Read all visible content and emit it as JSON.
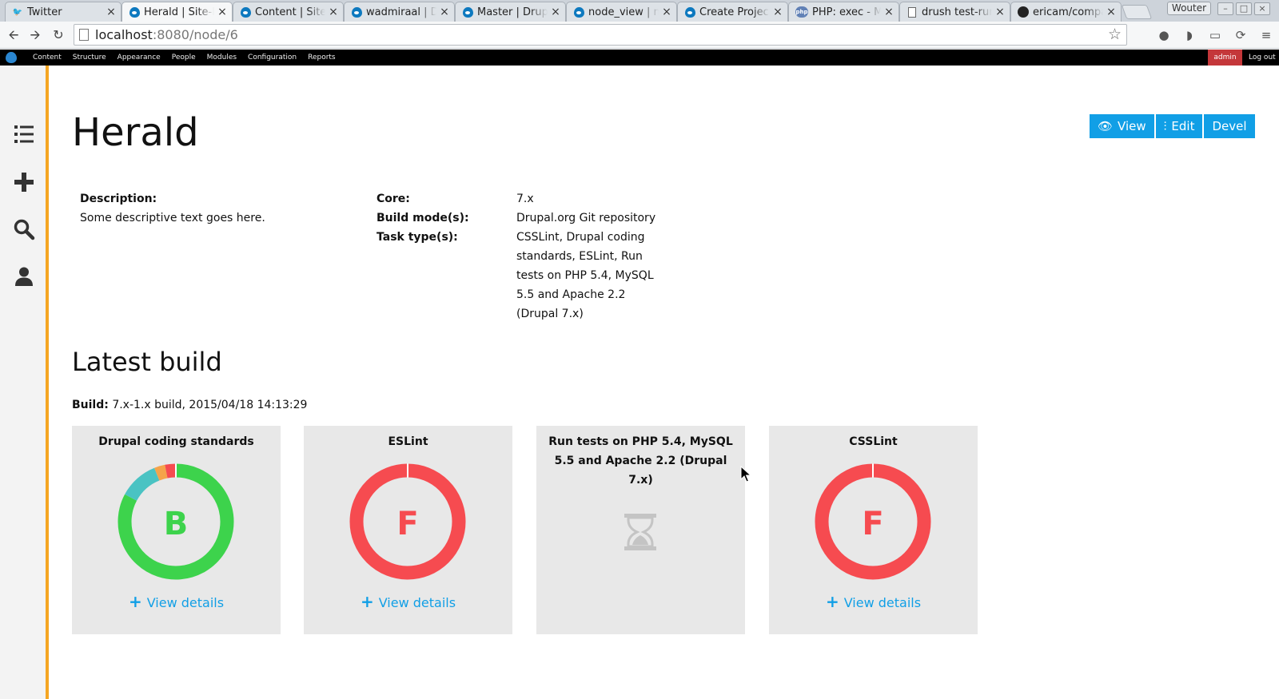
{
  "browser": {
    "tabs": [
      {
        "title": "Twitter",
        "icon": "twitter-icon"
      },
      {
        "title": "Herald | Site-I",
        "icon": "drupal-icon",
        "active": true
      },
      {
        "title": "Content | Site",
        "icon": "drupal-icon"
      },
      {
        "title": "wadmiraal | D",
        "icon": "drupal-icon"
      },
      {
        "title": "Master | Drupa",
        "icon": "drupal-icon"
      },
      {
        "title": "node_view | n",
        "icon": "drupal-icon"
      },
      {
        "title": "Create Project",
        "icon": "drupal-icon"
      },
      {
        "title": "PHP: exec - Ma",
        "icon": "php-icon"
      },
      {
        "title": "drush test-run",
        "icon": "page-icon"
      },
      {
        "title": "ericam/compa",
        "icon": "github-icon"
      }
    ],
    "php_favicon_text": "php",
    "profile_name": "Wouter",
    "url_host": "localhost",
    "url_path": ":8080/node/6"
  },
  "admin_toolbar": {
    "menu": [
      "Content",
      "Structure",
      "Appearance",
      "People",
      "Modules",
      "Configuration",
      "Reports"
    ],
    "user": "admin",
    "logout": "Log out"
  },
  "page": {
    "title": "Herald",
    "actions": {
      "view": "View",
      "edit": "Edit",
      "devel": "Devel"
    }
  },
  "details": {
    "description_label": "Description:",
    "description_value": "Some descriptive text goes here.",
    "core_label": "Core:",
    "core_value": "7.x",
    "build_modes_label": "Build mode(s):",
    "build_modes_value": "Drupal.org Git repository",
    "task_types_label": "Task type(s):",
    "task_types_value_lines": [
      "CSSLint, Drupal coding",
      "standards, ESLint, Run",
      "tests on PHP 5.4, MySQL",
      "5.5 and Apache 2.2",
      "(Drupal 7.x)"
    ]
  },
  "latest_build": {
    "heading": "Latest build",
    "build_label": "Build:",
    "build_value": "7.x-1.x build, 2015/04/18 14:13:29",
    "view_details_label": "View  details",
    "cards": [
      {
        "title": "Drupal coding standards",
        "grade": "B",
        "grade_color": "#3dd34c",
        "status": "done",
        "segments": [
          {
            "value": 82,
            "color": "#3dd34c"
          },
          {
            "value": 11,
            "color": "#4ac3c3"
          },
          {
            "value": 3,
            "color": "#f5a34a"
          },
          {
            "value": 3,
            "color": "#f64b50"
          }
        ]
      },
      {
        "title": "ESLint",
        "grade": "F",
        "grade_color": "#f64b50",
        "status": "done",
        "segments": [
          {
            "value": 100,
            "color": "#f64b50"
          }
        ]
      },
      {
        "title": "Run tests on PHP 5.4, MySQL 5.5 and Apache 2.2 (Drupal 7.x)",
        "grade": "",
        "status": "pending",
        "icon": "hourglass-icon"
      },
      {
        "title": "CSSLint",
        "grade": "F",
        "grade_color": "#f64b50",
        "status": "done",
        "segments": [
          {
            "value": 100,
            "color": "#f64b50"
          }
        ]
      }
    ]
  },
  "colors": {
    "accent": "#119fe6",
    "sidebar_stripe": "#f5a623",
    "admin_badge": "#c4373a"
  }
}
